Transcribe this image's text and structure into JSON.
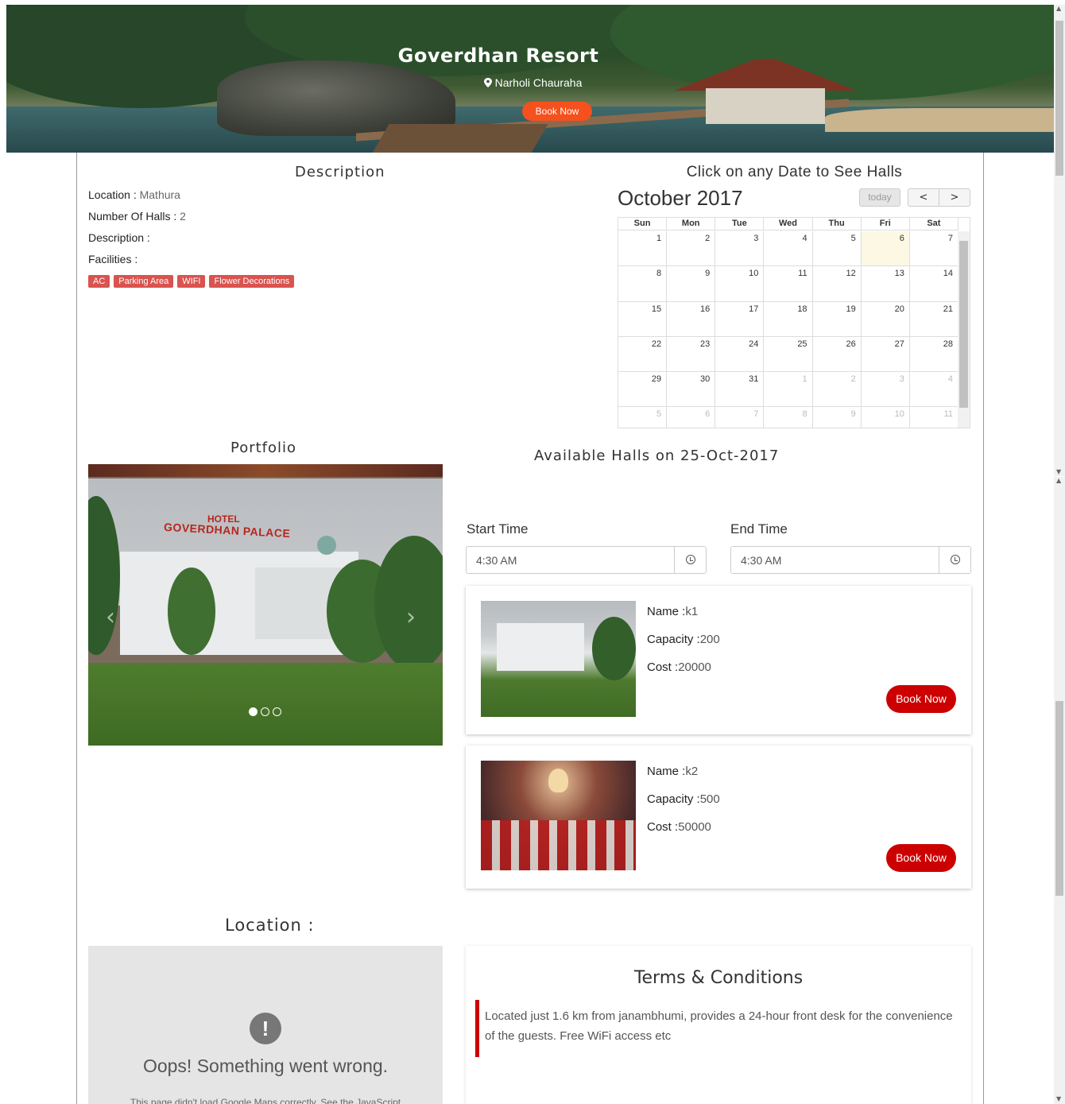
{
  "hero": {
    "title": "Goverdhan Resort",
    "location": "Narholi Chauraha",
    "book_label": "Book Now"
  },
  "description": {
    "heading": "Description",
    "location_label": "Location : ",
    "location_value": "Mathura",
    "halls_label": "Number Of Halls : ",
    "halls_value": "2",
    "desc_label": "Description :",
    "facilities_label": "Facilities :",
    "facilities": [
      "AC",
      "Parking Area",
      "WIFI",
      "Flower Decorations"
    ],
    "tag_color": "#d9534f"
  },
  "calendar": {
    "heading": "Click on any Date to See Halls",
    "month": "October 2017",
    "today_label": "today",
    "prev_label": "<",
    "next_label": ">",
    "weekdays": [
      "Sun",
      "Mon",
      "Tue",
      "Wed",
      "Thu",
      "Fri",
      "Sat"
    ],
    "weeks": [
      [
        [
          "1",
          ""
        ],
        [
          "2",
          ""
        ],
        [
          "3",
          ""
        ],
        [
          "4",
          ""
        ],
        [
          "5",
          ""
        ],
        [
          "6",
          "today"
        ],
        [
          "7",
          ""
        ]
      ],
      [
        [
          "8",
          ""
        ],
        [
          "9",
          ""
        ],
        [
          "10",
          ""
        ],
        [
          "11",
          ""
        ],
        [
          "12",
          ""
        ],
        [
          "13",
          ""
        ],
        [
          "14",
          ""
        ]
      ],
      [
        [
          "15",
          ""
        ],
        [
          "16",
          ""
        ],
        [
          "17",
          ""
        ],
        [
          "18",
          ""
        ],
        [
          "19",
          ""
        ],
        [
          "20",
          ""
        ],
        [
          "21",
          ""
        ]
      ],
      [
        [
          "22",
          ""
        ],
        [
          "23",
          ""
        ],
        [
          "24",
          ""
        ],
        [
          "25",
          ""
        ],
        [
          "26",
          ""
        ],
        [
          "27",
          ""
        ],
        [
          "28",
          ""
        ]
      ],
      [
        [
          "29",
          ""
        ],
        [
          "30",
          ""
        ],
        [
          "31",
          ""
        ],
        [
          "1",
          "other"
        ],
        [
          "2",
          "other"
        ],
        [
          "3",
          "other"
        ],
        [
          "4",
          "other"
        ]
      ],
      [
        [
          "5",
          "other"
        ],
        [
          "6",
          "other"
        ],
        [
          "7",
          "other"
        ],
        [
          "8",
          "other"
        ],
        [
          "9",
          "other"
        ],
        [
          "10",
          "other"
        ],
        [
          "11",
          "other"
        ]
      ]
    ]
  },
  "portfolio": {
    "heading": "Portfolio",
    "sign_top": "HOTEL",
    "sign": "GOVERDHAN PALACE",
    "slides": 3,
    "active_slide": 1
  },
  "halls": {
    "heading": "Available Halls on 25-Oct-2017",
    "start_label": "Start Time",
    "start_value": "4:30 AM",
    "end_label": "End Time",
    "end_value": "4:30 AM",
    "items": [
      {
        "name_label": "Name :",
        "name": "k1",
        "cap_label": "Capacity :",
        "capacity": "200",
        "cost_label": "Cost :",
        "cost": "20000",
        "book_label": "Book Now"
      },
      {
        "name_label": "Name :",
        "name": "k2",
        "cap_label": "Capacity :",
        "capacity": "500",
        "cost_label": "Cost :",
        "cost": "50000",
        "book_label": "Book Now"
      }
    ],
    "book_color": "#cc0000"
  },
  "location": {
    "heading": "Location :",
    "error_icon": "!",
    "error_title": "Oops! Something went wrong.",
    "error_detail": "This page didn't load Google Maps correctly. See the JavaScript"
  },
  "terms": {
    "heading": "Terms & Conditions",
    "text": "Located just 1.6 km from janambhumi, provides a 24-hour front desk for the convenience of the guests. Free WiFi access etc",
    "accent": "#cc0000"
  }
}
